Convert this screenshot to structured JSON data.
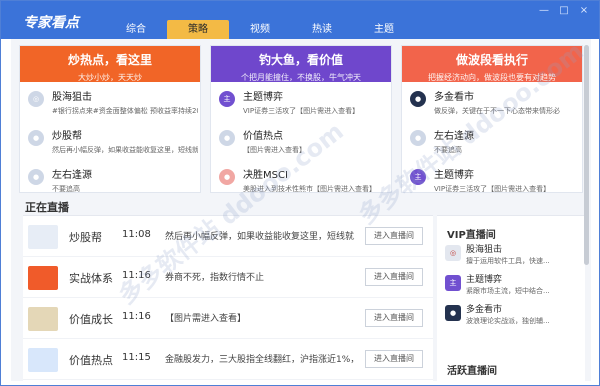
{
  "app": {
    "title": "专家看点"
  },
  "tabs": [
    "综合",
    "策略",
    "视频",
    "热读",
    "主题"
  ],
  "cards": [
    {
      "title": "炒热点，看这里",
      "subtitle": "大炒小炒，天天炒",
      "items": [
        {
          "name": "股海狙击",
          "desc": "#银行拐点来#资金面整体偏松 预收益率持续20"
        },
        {
          "name": "炒股帮",
          "desc": "然后再小幅反弹，如果收益能收复这里，短线就"
        },
        {
          "name": "左右逢源",
          "desc": "不要追高"
        }
      ]
    },
    {
      "title": "钓大鱼，看价值",
      "subtitle": "个把月能撞住，不换股，牛气冲天",
      "items": [
        {
          "name": "主题博弈",
          "desc": "VIP证券三活攻了【图片需进入查看】"
        },
        {
          "name": "价值热点",
          "desc": "【图片需进入查看】"
        },
        {
          "name": "决胜MSCI",
          "desc": "美股进入到技术性熊市【图片需进入查看】"
        }
      ]
    },
    {
      "title": "做波段看执行",
      "subtitle": "把握经济动向，做波段也要有对趋势",
      "items": [
        {
          "name": "多金看市",
          "desc": "做反弹，关键在于不一下心态带来情形必"
        },
        {
          "name": "左右逢源",
          "desc": "不要追高"
        },
        {
          "name": "主题博弈",
          "desc": "VIP证券三活攻了【图片需进入查看】"
        }
      ]
    }
  ],
  "live": {
    "title": "正在直播",
    "rows": [
      {
        "name": "炒股帮",
        "time": "11:08",
        "msg": "然后再小幅反弹，如果收益能收复这里，短线就...",
        "btn": "进入直播间"
      },
      {
        "name": "实战体系",
        "time": "11:16",
        "msg": "券商不死，指数行情不止",
        "btn": "进入直播间"
      },
      {
        "name": "价值成长",
        "time": "11:16",
        "msg": "【图片需进入查看】",
        "btn": "进入直播间"
      },
      {
        "name": "价值热点",
        "time": "11:15",
        "msg": "金融股发力，三大股指全线翻红，沪指涨近1%，...",
        "btn": "进入直播间"
      }
    ]
  },
  "vip": {
    "title": "VIP直播间",
    "items": [
      {
        "name": "股海狙击",
        "desc": "擅于运用软件工具，快速..."
      },
      {
        "name": "主题博弈",
        "desc": "紧跟市场主流，短中结合..."
      },
      {
        "name": "多金看市",
        "desc": "波浪理论实战派，独创辅..."
      }
    ]
  },
  "active": {
    "title": "活跃直播间"
  },
  "colors": {
    "topbar": "#3b73d9",
    "orange": "#f16527",
    "purple": "#6f47cc",
    "coral": "#f2644b"
  },
  "icons": {
    "win_controls": [
      "minimize-icon",
      "maximize-icon",
      "close-icon"
    ]
  },
  "watermark": "多多软件站 ddooo.com"
}
